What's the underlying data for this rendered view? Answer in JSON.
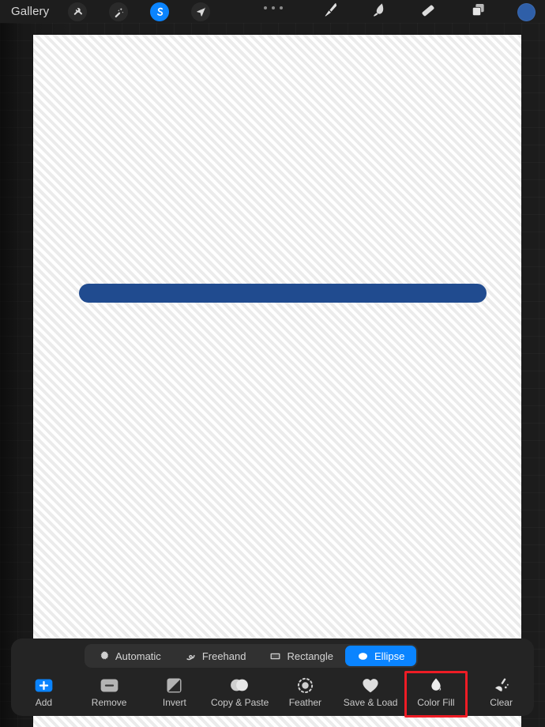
{
  "app": {
    "name": "Procreate",
    "accent_blue": "#0a84ff",
    "highlight_red": "#ee1c25",
    "stroke_color": "#204b8f",
    "swatch_color": "#2f5fa8"
  },
  "topbar": {
    "gallery_label": "Gallery",
    "left_tools": [
      {
        "name": "actions-wrench",
        "icon": "wrench-icon",
        "active": false
      },
      {
        "name": "adjustments",
        "icon": "magic-wand-icon",
        "active": false
      },
      {
        "name": "selection",
        "icon": "s-curve-icon",
        "active": true
      },
      {
        "name": "transform",
        "icon": "arrow-cursor-icon",
        "active": false
      }
    ],
    "overflow_menu": "more-dots-icon",
    "right_tools": [
      {
        "name": "paint",
        "icon": "brush-icon"
      },
      {
        "name": "smudge",
        "icon": "smudge-icon"
      },
      {
        "name": "erase",
        "icon": "eraser-icon"
      },
      {
        "name": "layers",
        "icon": "layers-icon"
      }
    ],
    "color_swatch": "color-swatch"
  },
  "canvas": {
    "name": "drawing-canvas",
    "stroke_shape": "rounded-bar"
  },
  "selection_panel": {
    "modes": [
      {
        "label": "Automatic",
        "icon": "burst-icon",
        "selected": false
      },
      {
        "label": "Freehand",
        "icon": "freehand-icon",
        "selected": false
      },
      {
        "label": "Rectangle",
        "icon": "rectangle-icon",
        "selected": false
      },
      {
        "label": "Ellipse",
        "icon": "ellipse-icon",
        "selected": true
      }
    ],
    "actions": [
      {
        "label": "Add",
        "icon": "plus-square-icon",
        "active": true,
        "highlighted": false
      },
      {
        "label": "Remove",
        "icon": "minus-square-icon",
        "active": false,
        "highlighted": false
      },
      {
        "label": "Invert",
        "icon": "invert-square-icon",
        "active": false,
        "highlighted": false
      },
      {
        "label": "Copy & Paste",
        "icon": "overlapping-circles-icon",
        "active": false,
        "highlighted": false
      },
      {
        "label": "Feather",
        "icon": "dotted-circle-icon",
        "active": false,
        "highlighted": false
      },
      {
        "label": "Save & Load",
        "icon": "heart-icon",
        "active": false,
        "highlighted": false
      },
      {
        "label": "Color Fill",
        "icon": "paint-drop-icon",
        "active": false,
        "highlighted": true
      },
      {
        "label": "Clear",
        "icon": "broom-icon",
        "active": false,
        "highlighted": false
      }
    ]
  }
}
